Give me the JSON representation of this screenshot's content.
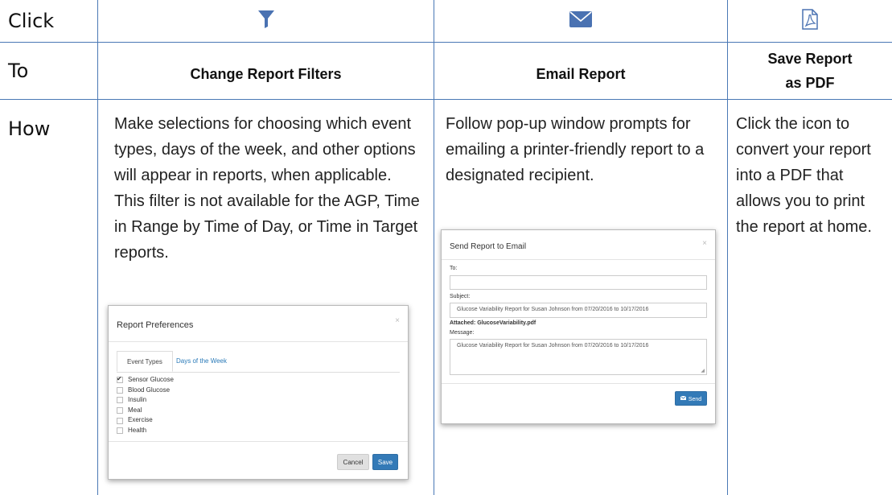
{
  "rows": {
    "click_label": "Click",
    "to_label": "To",
    "how_label": "How"
  },
  "icons": {
    "filter": "filter-icon",
    "email": "envelope-icon",
    "pdf": "pdf-file-icon",
    "icon_color": "#4a72b2"
  },
  "actions": {
    "filters": "Change Report Filters",
    "email": "Email Report",
    "pdf": "Save Report\nas PDF"
  },
  "how": {
    "filters": "Make selections for choosing which event types, days of the week, and other options will appear in reports, when applicable. This filter is not available for the AGP, Time in Range by Time of Day, or Time in Target reports.",
    "email": "Follow pop-up window prompts for emailing a printer-friendly report to a designated recipient.",
    "pdf": "Click the icon to convert your report into a PDF that allows you to print the report at home."
  },
  "prefs_modal": {
    "title": "Report Preferences",
    "close": "×",
    "tabs": [
      "Event Types",
      "Days of the Week"
    ],
    "items": [
      {
        "label": "Sensor Glucose",
        "checked": true
      },
      {
        "label": "Blood Glucose",
        "checked": false
      },
      {
        "label": "Insulin",
        "checked": false
      },
      {
        "label": "Meal",
        "checked": false
      },
      {
        "label": "Exercise",
        "checked": false
      },
      {
        "label": "Health",
        "checked": false
      }
    ],
    "cancel": "Cancel",
    "save": "Save"
  },
  "email_modal": {
    "title": "Send Report to Email",
    "close": "×",
    "to_label": "To:",
    "to_value": "",
    "subject_label": "Subject:",
    "subject_value": "Glucose Variability Report for Susan Johnson from 07/20/2016 to 10/17/2016",
    "attached": "Attached: GlucoseVariability.pdf",
    "message_label": "Message:",
    "message_value": "Glucose Variability Report for Susan Johnson from 07/20/2016 to 10/17/2016",
    "send": "Send"
  },
  "colors": {
    "border": "#4a78b5",
    "accent": "#337ab7"
  }
}
